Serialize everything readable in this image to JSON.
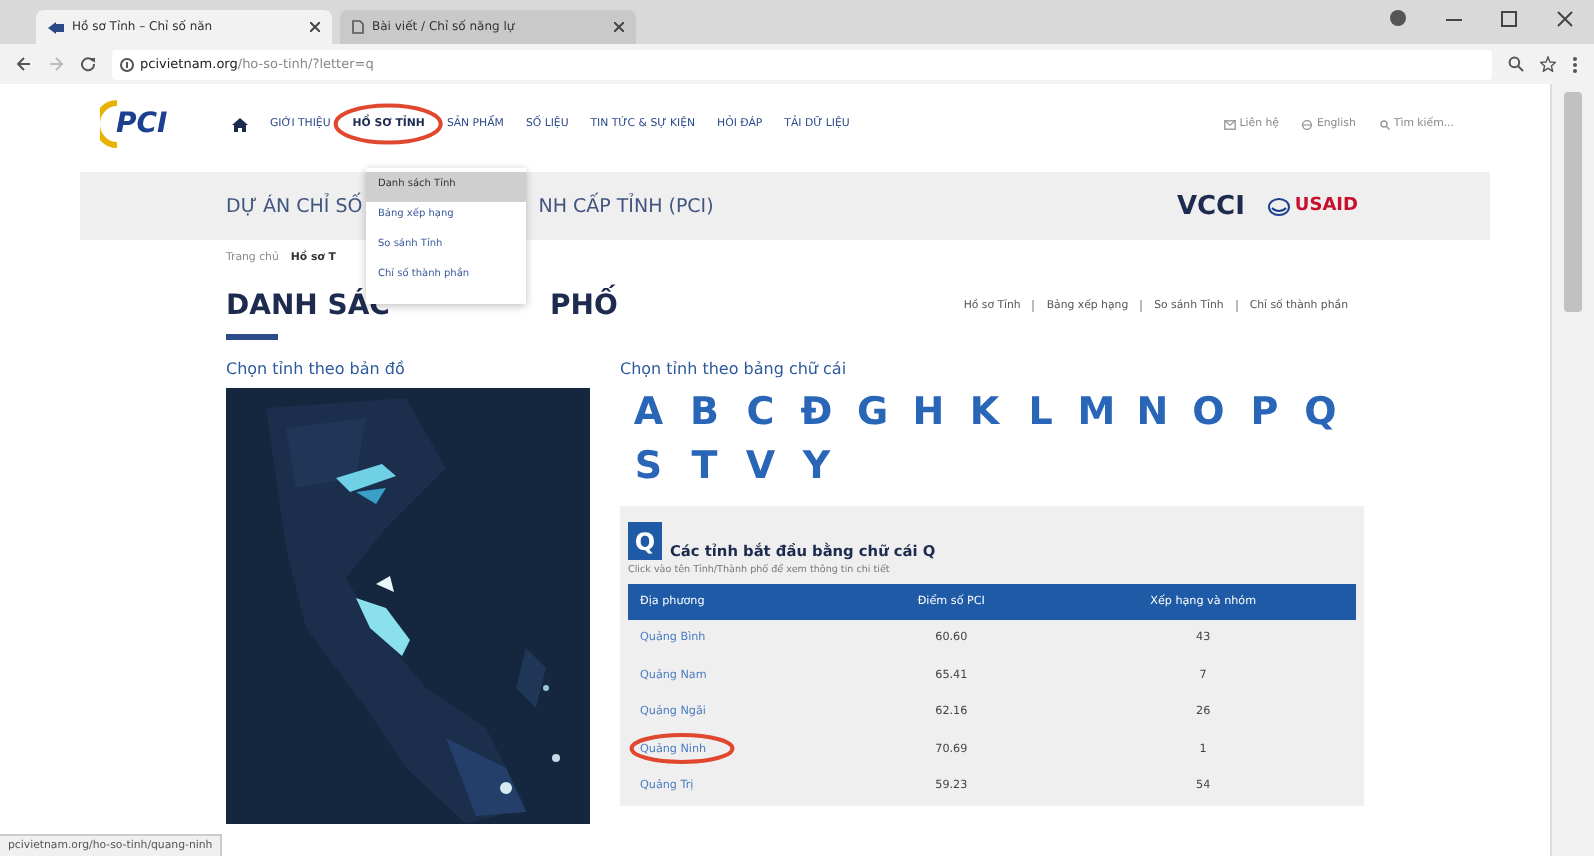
{
  "browser": {
    "tabs": [
      {
        "title": "Hồ sơ Tỉnh – Chỉ số năn",
        "selected": true
      },
      {
        "title": "Bài viết / Chỉ số năng lự",
        "selected": false
      }
    ],
    "url_host": "pcivietnam.org",
    "url_path": "/ho-so-tinh/?letter=q"
  },
  "site": {
    "logo": "PCI",
    "nav": [
      {
        "label": "GIỚI THIỆU",
        "selected": false,
        "circled": false
      },
      {
        "label": "HỒ SƠ TỈNH",
        "selected": true,
        "circled": true
      },
      {
        "label": "SẢN PHẨM",
        "selected": false,
        "circled": false
      },
      {
        "label": "SỐ LIỆU",
        "selected": false,
        "circled": false
      },
      {
        "label": "TIN TỨC & SỰ KIỆN",
        "selected": false,
        "circled": false
      },
      {
        "label": "HỎI ĐÁP",
        "selected": false,
        "circled": false
      },
      {
        "label": "TẢI DỮ LIỆU",
        "selected": false,
        "circled": false
      }
    ],
    "top_links": [
      "Liên hệ",
      "English",
      "Tìm kiếm..."
    ],
    "dropdown": [
      {
        "label": "Danh sách Tỉnh",
        "selected": true
      },
      {
        "label": "Bảng xếp hạng",
        "selected": false
      },
      {
        "label": "So sánh Tỉnh",
        "selected": false
      },
      {
        "label": "Chỉ số thành phần",
        "selected": false
      }
    ],
    "banner": {
      "left": "DỰ ÁN CHỈ SỐ",
      "right": "NH CẤP TỈNH (PCI)",
      "partner_logos": [
        "VCCI",
        "USAID"
      ]
    },
    "breadcrumb": [
      "Trang chủ",
      "Hồ sơ T"
    ],
    "title_parts": [
      "DANH SÁC",
      "PHỐ"
    ],
    "title_links": [
      "Hồ sơ Tỉnh",
      "Bảng xếp hạng",
      "So sánh Tỉnh",
      "Chỉ số thành phần"
    ],
    "map": {
      "heading": "Chọn tỉnh theo bản đồ",
      "kind": "picture"
    },
    "alphabet": {
      "heading": "Chọn tỉnh theo bảng chữ cái",
      "letters": [
        "A",
        "B",
        "C",
        "Đ",
        "G",
        "H",
        "K",
        "L",
        "M",
        "N",
        "O",
        "P",
        "Q",
        "S",
        "T",
        "V",
        "Y"
      ]
    },
    "panel": {
      "letter": "Q",
      "title": "Các tỉnh bắt đầu bằng chữ cái Q",
      "hint": "Click vào tên Tỉnh/Thành phố để xem thông tin chi tiết",
      "table": {
        "columns": [
          "Địa phương",
          "Điểm số PCI",
          "Xếp hạng và nhóm"
        ],
        "rows": [
          {
            "cells": [
              "Quảng Bình",
              "60.60",
              "43"
            ],
            "circled": false
          },
          {
            "cells": [
              "Quảng Nam",
              "65.41",
              "7"
            ],
            "circled": false
          },
          {
            "cells": [
              "Quảng Ngãi",
              "62.16",
              "26"
            ],
            "circled": false
          },
          {
            "cells": [
              "Quảng Ninh",
              "70.69",
              "1"
            ],
            "circled": true
          },
          {
            "cells": [
              "Quảng Trị",
              "59.23",
              "54"
            ],
            "circled": false
          }
        ]
      }
    }
  },
  "status_bar": "pcivietnam.org/ho-so-tinh/quang-ninh"
}
